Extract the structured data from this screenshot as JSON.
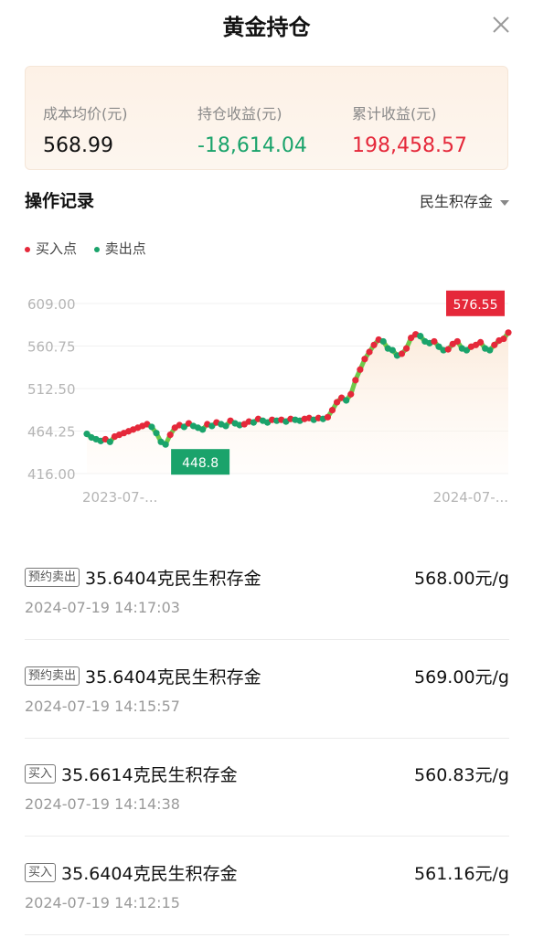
{
  "header": {
    "title": "黄金持仓"
  },
  "summary": {
    "cost_label": "成本均价(元)",
    "cost_value": "568.99",
    "hold_label": "持仓收益(元)",
    "hold_value": "-18,614.04",
    "total_label": "累计收益(元)",
    "total_value": "198,458.57"
  },
  "section": {
    "title": "操作记录",
    "selector": "民生积存金"
  },
  "legend": {
    "buy": "买入点",
    "sell": "卖出点"
  },
  "colors": {
    "buy": "#e5283a",
    "sell": "#1aa36b",
    "line": "#6fc94a"
  },
  "chart_data": {
    "type": "line",
    "y_ticks": [
      "609.00",
      "560.75",
      "512.50",
      "464.25",
      "416.00"
    ],
    "ylim": [
      416.0,
      609.0
    ],
    "x_ticks": [
      "2023-07-...",
      "2024-07-..."
    ],
    "min_label": "448.8",
    "max_label": "576.55",
    "series": [
      {
        "values": [
          461,
          457,
          455,
          453,
          455,
          452,
          458,
          460,
          462,
          464,
          466,
          468,
          470,
          472,
          469,
          462,
          452,
          449,
          460,
          468,
          471,
          469,
          473,
          470,
          468,
          466,
          472,
          470,
          474,
          472,
          470,
          476,
          473,
          471,
          472,
          475,
          474,
          478,
          476,
          474,
          477,
          476,
          477,
          475,
          478,
          477,
          476,
          478,
          479,
          477,
          479,
          478,
          480,
          488,
          497,
          502,
          499,
          506,
          522,
          534,
          546,
          554,
          562,
          568,
          566,
          558,
          556,
          550,
          552,
          558,
          570,
          574,
          572,
          566,
          564,
          566,
          560,
          556,
          557,
          563,
          566,
          558,
          556,
          560,
          562,
          565,
          558,
          556,
          562,
          567,
          569,
          576
        ]
      }
    ]
  },
  "records": [
    {
      "tag": "预约卖出",
      "name": "35.6404克民生积存金",
      "price": "568.00元/g",
      "time": "2024-07-19 14:17:03"
    },
    {
      "tag": "预约卖出",
      "name": "35.6404克民生积存金",
      "price": "569.00元/g",
      "time": "2024-07-19 14:15:57"
    },
    {
      "tag": "买入",
      "name": "35.6614克民生积存金",
      "price": "560.83元/g",
      "time": "2024-07-19 14:14:38"
    },
    {
      "tag": "买入",
      "name": "35.6404克民生积存金",
      "price": "561.16元/g",
      "time": "2024-07-19 14:12:15"
    }
  ]
}
